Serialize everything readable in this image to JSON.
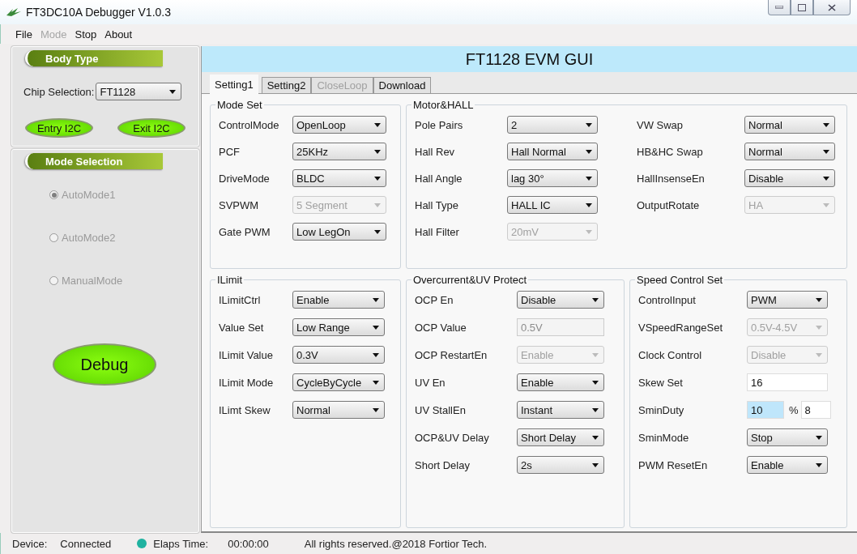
{
  "window": {
    "title": "FT3DC10A Debugger V1.0.3"
  },
  "menu": [
    {
      "label": "File",
      "disabled": false
    },
    {
      "label": "Mode",
      "disabled": true
    },
    {
      "label": "Stop",
      "disabled": false
    },
    {
      "label": "About",
      "disabled": false
    }
  ],
  "body_type": {
    "title": "Body Type",
    "chip_label": "Chip Selection:",
    "chip_value": "FT1128",
    "buttons": [
      "Entry I2C",
      "Exit I2C"
    ]
  },
  "mode_selection": {
    "title": "Mode Selection",
    "options": [
      {
        "label": "AutoMode1",
        "selected": true,
        "disabled": true
      },
      {
        "label": "AutoMode2",
        "selected": false,
        "disabled": true
      },
      {
        "label": "ManualMode",
        "selected": false,
        "disabled": true
      }
    ],
    "debug_button": "Debug"
  },
  "header": {
    "title": "FT1128 EVM GUI"
  },
  "tabs": [
    {
      "label": "Setting1",
      "selected": true,
      "disabled": false
    },
    {
      "label": "Setting2",
      "selected": false,
      "disabled": false
    },
    {
      "label": "CloseLoop",
      "selected": false,
      "disabled": true
    },
    {
      "label": "Download",
      "selected": false,
      "disabled": false
    }
  ],
  "groups": [
    {
      "title": "Mode Set",
      "columns": [
        [
          {
            "kind": "combo",
            "label": "ControlMode",
            "value": "OpenLoop",
            "disabled": false
          },
          {
            "kind": "combo",
            "label": "PCF",
            "value": "25KHz",
            "disabled": false
          },
          {
            "kind": "combo",
            "label": "DriveMode",
            "value": "BLDC",
            "disabled": false
          },
          {
            "kind": "combo",
            "label": "SVPWM",
            "value": "5 Segment",
            "disabled": true
          },
          {
            "kind": "combo",
            "label": "Gate PWM",
            "value": "Low LegOn",
            "disabled": false
          }
        ]
      ]
    },
    {
      "title": "Motor&HALL",
      "columns": [
        [
          {
            "kind": "combo",
            "label": "Pole Pairs",
            "value": "2",
            "disabled": false
          },
          {
            "kind": "combo",
            "label": "Hall Rev",
            "value": "Hall Normal",
            "disabled": false
          },
          {
            "kind": "combo",
            "label": "Hall Angle",
            "value": "lag 30°",
            "disabled": false
          },
          {
            "kind": "combo",
            "label": "Hall Type",
            "value": "HALL IC",
            "disabled": false
          },
          {
            "kind": "combo",
            "label": "Hall Filter",
            "value": "20mV",
            "disabled": true
          }
        ],
        [
          {
            "kind": "combo",
            "label": "VW Swap",
            "value": "Normal",
            "disabled": false
          },
          {
            "kind": "combo",
            "label": "HB&HC Swap",
            "value": "Normal",
            "disabled": false
          },
          {
            "kind": "combo",
            "label": "HallInsenseEn",
            "value": "Disable",
            "disabled": false
          },
          {
            "kind": "combo",
            "label": "OutputRotate",
            "value": "HA",
            "disabled": true
          }
        ]
      ]
    },
    {
      "title": "ILimit",
      "columns": [
        [
          {
            "kind": "combo",
            "label": "ILimitCtrl",
            "value": "Enable",
            "disabled": false
          },
          {
            "kind": "combo",
            "label": "Value Set",
            "value": "Low Range",
            "disabled": false
          },
          {
            "kind": "combo",
            "label": "ILimit Value",
            "value": "0.3V",
            "disabled": false
          },
          {
            "kind": "combo",
            "label": "ILimit Mode",
            "value": "CycleByCycle",
            "disabled": false
          },
          {
            "kind": "combo",
            "label": "ILimt Skew",
            "value": "Normal",
            "disabled": false
          }
        ]
      ]
    },
    {
      "title": "Overcurrent&UV Protect",
      "columns": [
        [
          {
            "kind": "combo",
            "label": "OCP En",
            "value": "Disable",
            "disabled": false
          },
          {
            "kind": "text",
            "label": "OCP Value",
            "value": "0.5V",
            "disabled": true
          },
          {
            "kind": "combo",
            "label": "OCP RestartEn",
            "value": "Enable",
            "disabled": true
          },
          {
            "kind": "combo",
            "label": "UV En",
            "value": "Enable",
            "disabled": false
          },
          {
            "kind": "combo",
            "label": "UV StallEn",
            "value": "Instant",
            "disabled": false
          },
          {
            "kind": "combo",
            "label": "OCP&UV Delay",
            "value": "Short Delay",
            "disabled": false
          },
          {
            "kind": "combo",
            "label": "Short Delay",
            "value": "2s",
            "disabled": false
          }
        ]
      ]
    },
    {
      "title": "Speed Control Set",
      "columns": [
        [
          {
            "kind": "combo",
            "label": "ControlInput",
            "value": "PWM",
            "disabled": false
          },
          {
            "kind": "combo",
            "label": "VSpeedRangeSet",
            "value": "0.5V-4.5V",
            "disabled": true
          },
          {
            "kind": "combo",
            "label": "Clock Control",
            "value": "Disable",
            "disabled": true
          },
          {
            "kind": "text",
            "label": "Skew Set",
            "value": "16",
            "disabled": false
          },
          {
            "kind": "duty",
            "label": "SminDuty",
            "value": "10",
            "value_selected": true,
            "unit": "%",
            "value_2": "8"
          },
          {
            "kind": "combo",
            "label": "SminMode",
            "value": "Stop",
            "disabled": false
          },
          {
            "kind": "combo",
            "label": "PWM ResetEn",
            "value": "Enable",
            "disabled": false
          }
        ]
      ]
    }
  ],
  "status_bar": {
    "device_label": "Device:",
    "device_value": "Connected",
    "time_label": "Elaps Time:",
    "time_value": "00:00:00",
    "copyright": "All rights reserved.@2018 Fortior Tech."
  }
}
